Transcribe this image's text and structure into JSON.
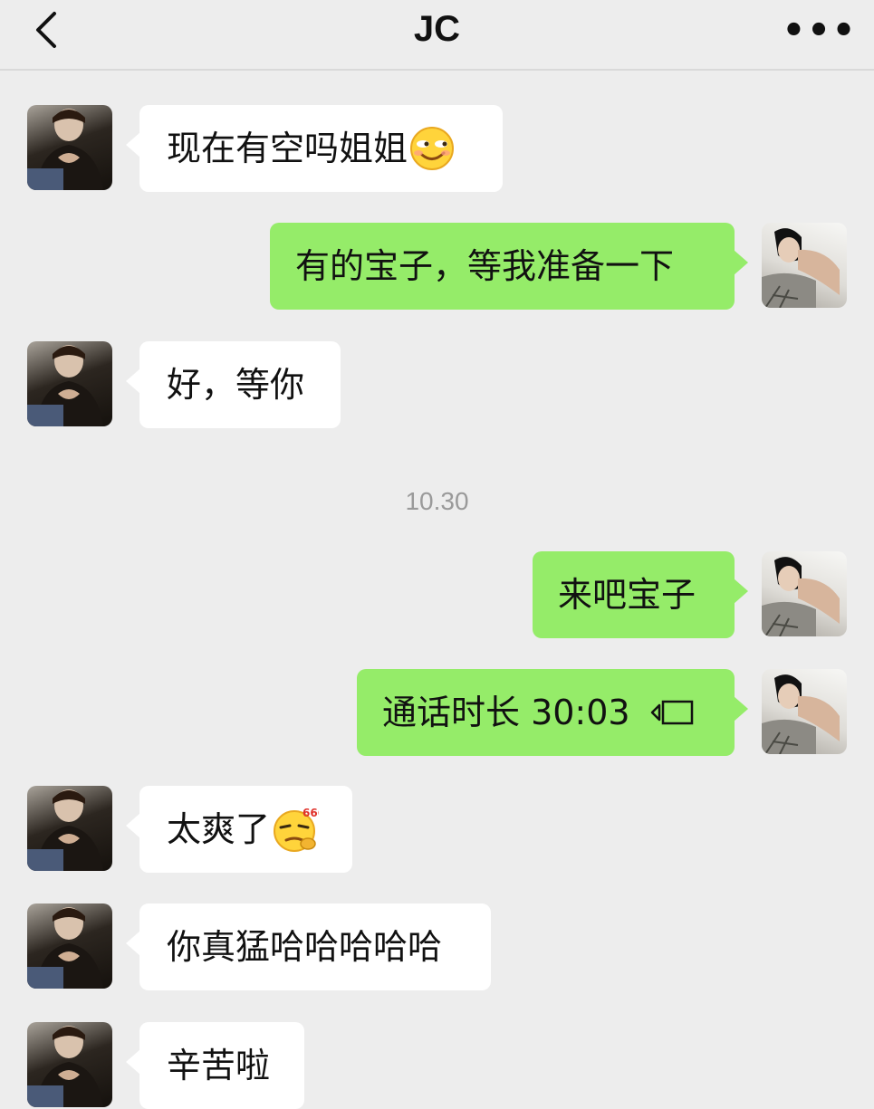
{
  "header": {
    "back_icon": "chevron-left-icon",
    "title": "JC",
    "more_label": "•••"
  },
  "colors": {
    "background": "#ededed",
    "incoming_bubble": "#ffffff",
    "outgoing_bubble": "#95ec69",
    "timestamp": "#9a9a9a"
  },
  "messages": [
    {
      "from": "JC",
      "text": "现在有空吗姐姐",
      "emoji": "smirk-face-emoji"
    },
    {
      "from": "me",
      "text": "有的宝子，等我准备一下"
    },
    {
      "from": "JC",
      "text": "好，等你"
    },
    {
      "from": "me",
      "text": "来吧宝子"
    },
    {
      "from": "me",
      "text": "通话时长 30:03",
      "icon": "video-call-icon"
    },
    {
      "from": "JC",
      "text": "太爽了",
      "emoji": "666-thinking-face-emoji"
    },
    {
      "from": "JC",
      "text": "你真猛哈哈哈哈哈"
    },
    {
      "from": "JC",
      "text": "辛苦啦"
    }
  ],
  "timestamp": "10.30"
}
